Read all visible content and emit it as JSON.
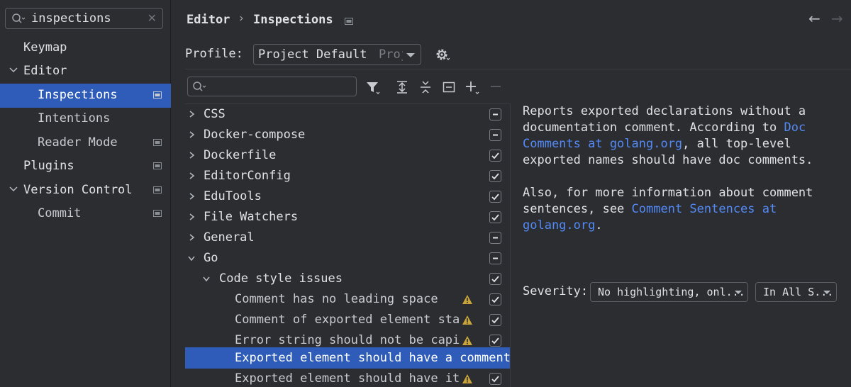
{
  "sidebar": {
    "search": {
      "value": "inspections",
      "icon": "search-icon",
      "clear_icon": "close-icon"
    },
    "items": [
      {
        "label": "Keymap",
        "expanded": null,
        "selected": false,
        "badge": false
      },
      {
        "label": "Editor",
        "expanded": true,
        "selected": false,
        "badge": false
      },
      {
        "label": "Inspections",
        "expanded": null,
        "selected": true,
        "badge": true
      },
      {
        "label": "Intentions",
        "expanded": null,
        "selected": false,
        "badge": false
      },
      {
        "label": "Reader Mode",
        "expanded": null,
        "selected": false,
        "badge": true
      },
      {
        "label": "Plugins",
        "expanded": null,
        "selected": false,
        "badge": true
      },
      {
        "label": "Version Control",
        "expanded": true,
        "selected": false,
        "badge": true
      },
      {
        "label": "Commit",
        "expanded": null,
        "selected": false,
        "badge": true
      }
    ]
  },
  "header": {
    "breadcrumb": [
      "Editor",
      "Inspections"
    ],
    "separator": "›",
    "back_icon": "←",
    "forward_icon": "→"
  },
  "profile": {
    "label": "Profile:",
    "value": "Project Default",
    "secondary": "Project"
  },
  "tree": {
    "rows": [
      {
        "label": "CSS",
        "chevron": "right",
        "state": "mixed",
        "warn": false,
        "selected": false
      },
      {
        "label": "Docker-compose",
        "chevron": "right",
        "state": "mixed",
        "warn": false,
        "selected": false
      },
      {
        "label": "Dockerfile",
        "chevron": "right",
        "state": "checked",
        "warn": false,
        "selected": false
      },
      {
        "label": "EditorConfig",
        "chevron": "right",
        "state": "checked",
        "warn": false,
        "selected": false
      },
      {
        "label": "EduTools",
        "chevron": "right",
        "state": "checked",
        "warn": false,
        "selected": false
      },
      {
        "label": "File Watchers",
        "chevron": "right",
        "state": "checked",
        "warn": false,
        "selected": false
      },
      {
        "label": "General",
        "chevron": "right",
        "state": "mixed",
        "warn": false,
        "selected": false
      },
      {
        "label": "Go",
        "chevron": "down",
        "state": "mixed",
        "warn": false,
        "selected": false
      },
      {
        "label": "Code style issues",
        "chevron": "down",
        "state": "checked",
        "warn": false,
        "selected": false
      },
      {
        "label": "Comment has no leading space",
        "chevron": null,
        "state": "checked",
        "warn": true,
        "selected": false
      },
      {
        "label": "Comment of exported element starts",
        "chevron": null,
        "state": "checked",
        "warn": true,
        "selected": false
      },
      {
        "label": "Error string should not be capitalized",
        "chevron": null,
        "state": "checked",
        "warn": true,
        "selected": false
      },
      {
        "label": "Exported element should have a comment",
        "chevron": null,
        "state": "none",
        "warn": false,
        "selected": true
      },
      {
        "label": "Exported element should have its",
        "chevron": null,
        "state": "checked",
        "warn": true,
        "selected": false
      }
    ]
  },
  "description": {
    "p1_text": "Reports exported declarations without a documentation comment. According to ",
    "p1_link": "Doc Comments at golang.org",
    "p1_tail": ", all top-level exported names should have doc comments.",
    "p2_text": "Also, for more information about comment sentences, see ",
    "p2_link": "Comment Sentences at golang.org",
    "p2_tail": "."
  },
  "severity": {
    "label": "Severity:",
    "value": "No highlighting, onl...",
    "scope": "In All S..."
  },
  "colors": {
    "accent": "#2e5cb8",
    "link": "#548af7",
    "warning": "#c9a43a"
  }
}
